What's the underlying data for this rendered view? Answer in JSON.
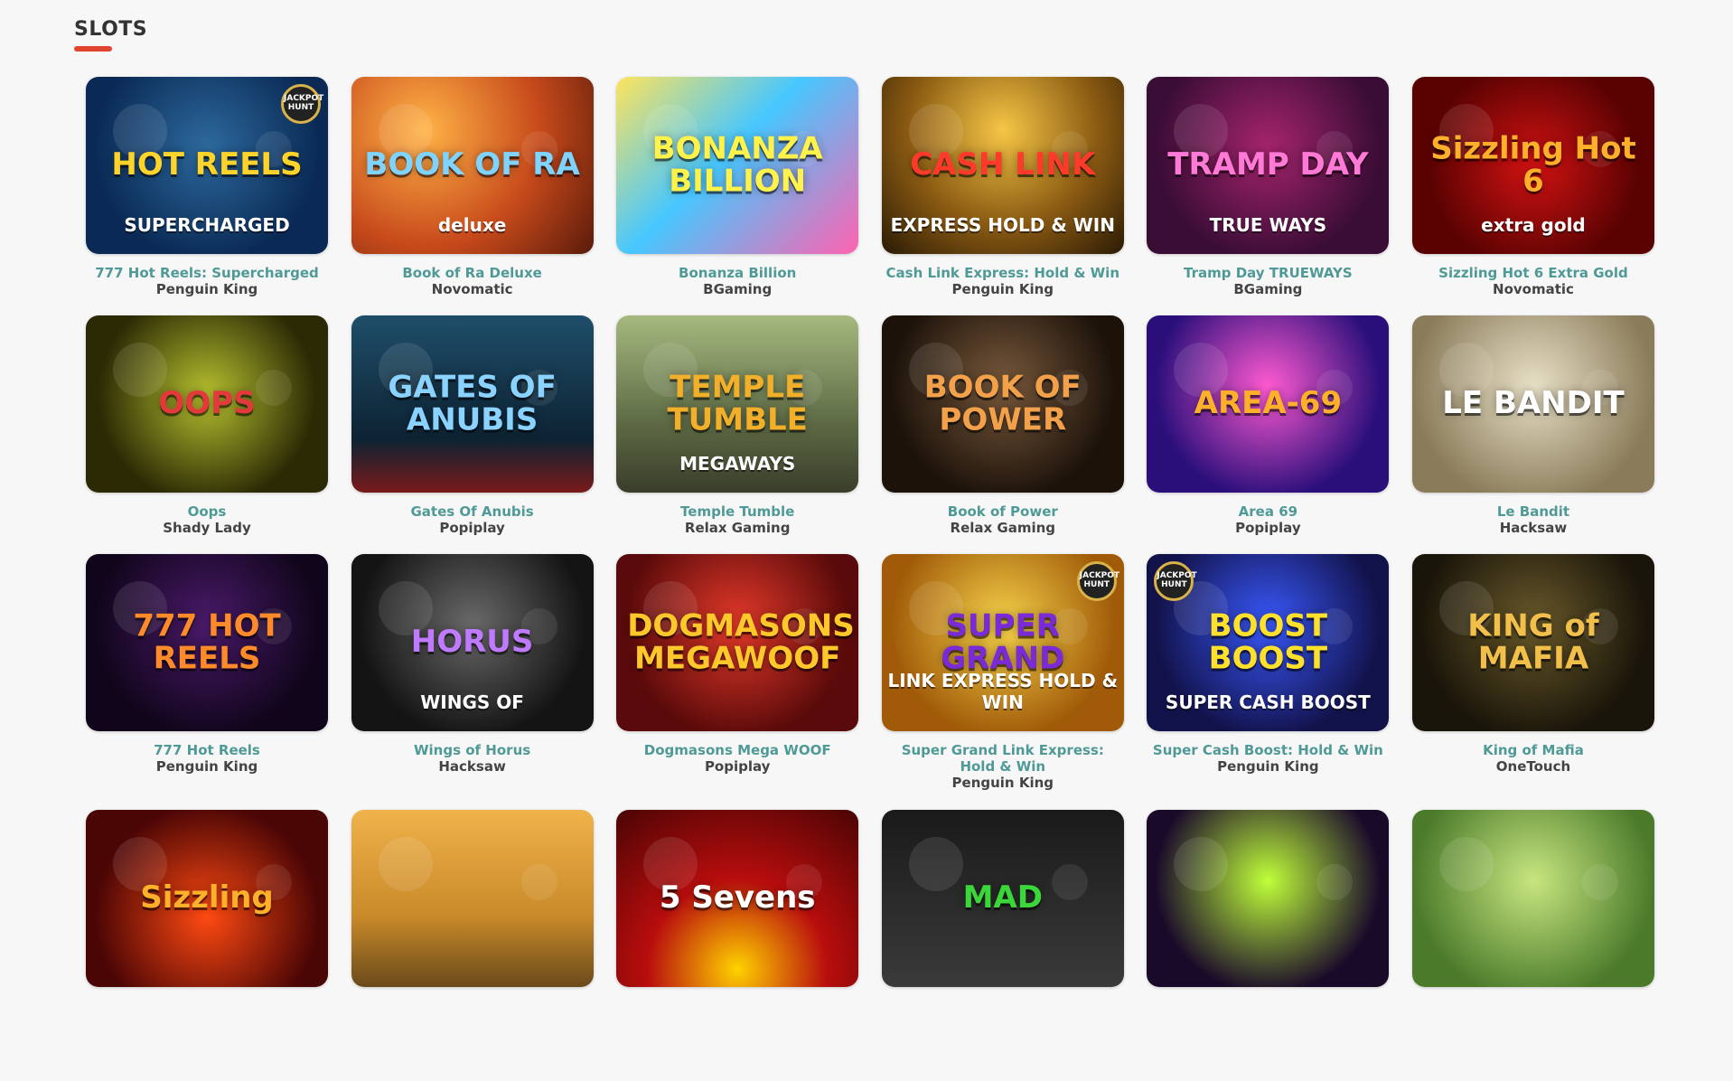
{
  "section": {
    "title": "SLOTS"
  },
  "games": [
    {
      "name": "777 Hot Reels: Supercharged",
      "provider": "Penguin King",
      "art_title": "HOT REELS",
      "art_sub": "SUPERCHARGED",
      "title_color": "#ffd42a",
      "badge": "JACKPOT HUNT"
    },
    {
      "name": "Book of Ra Deluxe",
      "provider": "Novomatic",
      "art_title": "BOOK OF RA",
      "art_sub": "deluxe",
      "title_color": "#7fd4ff"
    },
    {
      "name": "Bonanza Billion",
      "provider": "BGaming",
      "art_title": "BONANZA BILLION",
      "art_sub": "",
      "title_color": "#fff24a"
    },
    {
      "name": "Cash Link Express: Hold & Win",
      "provider": "Penguin King",
      "art_title": "CASH LINK",
      "art_sub": "EXPRESS HOLD & WIN",
      "title_color": "#ff3a2a"
    },
    {
      "name": "Tramp Day TRUEWAYS",
      "provider": "BGaming",
      "art_title": "TRAMP DAY",
      "art_sub": "TRUE WAYS",
      "title_color": "#ff7ad6"
    },
    {
      "name": "Sizzling Hot 6 Extra Gold",
      "provider": "Novomatic",
      "art_title": "Sizzling Hot 6",
      "art_sub": "extra gold",
      "title_color": "#ffb02a"
    },
    {
      "name": "Oops",
      "provider": "Shady Lady",
      "art_title": "OOPS",
      "art_sub": "",
      "title_color": "#e23a3a"
    },
    {
      "name": "Gates Of Anubis",
      "provider": "Popiplay",
      "art_title": "GATES OF ANUBIS",
      "art_sub": "",
      "title_color": "#8ad2ff"
    },
    {
      "name": "Temple Tumble",
      "provider": "Relax Gaming",
      "art_title": "TEMPLE TUMBLE",
      "art_sub": "MEGAWAYS",
      "title_color": "#f2b02a"
    },
    {
      "name": "Book of Power",
      "provider": "Relax Gaming",
      "art_title": "BOOK OF POWER",
      "art_sub": "",
      "title_color": "#f2a04a"
    },
    {
      "name": "Area 69",
      "provider": "Popiplay",
      "art_title": "AREA-69",
      "art_sub": "",
      "title_color": "#ffb02a"
    },
    {
      "name": "Le Bandit",
      "provider": "Hacksaw",
      "art_title": "LE BANDIT",
      "art_sub": "",
      "title_color": "#ffffff"
    },
    {
      "name": "777 Hot Reels",
      "provider": "Penguin King",
      "art_title": "777 HOT REELS",
      "art_sub": "",
      "title_color": "#ff8a2a"
    },
    {
      "name": "Wings of Horus",
      "provider": "Hacksaw",
      "art_title": "HORUS",
      "art_sub": "WINGS OF",
      "title_color": "#c07aff"
    },
    {
      "name": "Dogmasons Mega WOOF",
      "provider": "Popiplay",
      "art_title": "DOGMASONS MEGAWOOF",
      "art_sub": "",
      "title_color": "#ffc82a"
    },
    {
      "name": "Super Grand Link Express: Hold & Win",
      "provider": "Penguin King",
      "art_title": "SUPER GRAND",
      "art_sub": "LINK EXPRESS HOLD & WIN",
      "title_color": "#7a2ad6",
      "badge": "JACKPOT HUNT"
    },
    {
      "name": "Super Cash Boost: Hold & Win",
      "provider": "Penguin King",
      "art_title": "BOOST BOOST",
      "art_sub": "SUPER CASH BOOST",
      "title_color": "#ffe02a",
      "badge": "JACKPOT HUNT",
      "badge_left": true
    },
    {
      "name": "King of Mafia",
      "provider": "OneTouch",
      "art_title": "KING of MAFIA",
      "art_sub": "",
      "title_color": "#f2c04a"
    },
    {
      "name": "",
      "provider": "",
      "art_title": "Sizzling",
      "art_sub": "",
      "title_color": "#ffb02a"
    },
    {
      "name": "",
      "provider": "",
      "art_title": "",
      "art_sub": "",
      "title_color": "#ffffff"
    },
    {
      "name": "",
      "provider": "",
      "art_title": "5 Sevens",
      "art_sub": "",
      "title_color": "#ffffff"
    },
    {
      "name": "",
      "provider": "",
      "art_title": "MAD",
      "art_sub": "",
      "title_color": "#3ad63a"
    },
    {
      "name": "",
      "provider": "",
      "art_title": "",
      "art_sub": "",
      "title_color": "#ffffff"
    },
    {
      "name": "",
      "provider": "",
      "art_title": "",
      "art_sub": "",
      "title_color": "#ffffff"
    }
  ],
  "colors": {
    "accent": "#e2452f",
    "game_name": "#4f9a96",
    "provider": "#444444",
    "background": "#f7f7f7"
  }
}
